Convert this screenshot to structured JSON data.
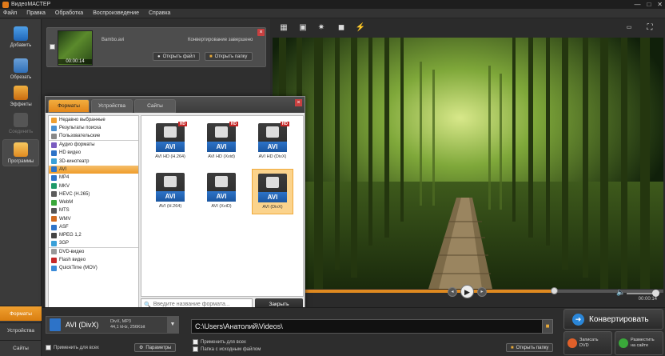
{
  "window": {
    "title": "ВидеоМАСТЕР"
  },
  "menu": [
    "Файл",
    "Правка",
    "Обработка",
    "Воспроизведение",
    "Справка"
  ],
  "sidebar": {
    "items": [
      {
        "label": "Добавить",
        "icon": "add-file-icon"
      },
      {
        "label": "Обрезать",
        "icon": "cut-icon"
      },
      {
        "label": "Эффекты",
        "icon": "effects-icon"
      },
      {
        "label": "Соединить",
        "icon": "join-icon"
      },
      {
        "label": "Программы",
        "icon": "programs-icon"
      }
    ],
    "bottom_tabs": [
      "Форматы",
      "Устройства",
      "Сайты"
    ]
  },
  "file_card": {
    "name": "Вambo.avi",
    "duration": "00:00:14",
    "status": "Конвертирование завершено",
    "open_file": "Открыть файл",
    "open_folder": "Открыть папку"
  },
  "player": {
    "time": "00:00:14",
    "progress": 0.72,
    "volume": 0.8
  },
  "dialog": {
    "tabs": [
      "Форматы",
      "Устройства",
      "Сайты"
    ],
    "list": [
      {
        "label": "Недавно выбранные",
        "color": "#f0a030"
      },
      {
        "label": "Результаты поиска",
        "color": "#4a90d0"
      },
      {
        "label": "Пользовательские",
        "color": "#888888"
      },
      {
        "label": "Аудио форматы",
        "color": "#7a5cc0"
      },
      {
        "label": "HD видео",
        "color": "#2d73c8"
      },
      {
        "label": "3D-кинотеатр",
        "color": "#3aa0d8"
      },
      {
        "label": "AVI",
        "color": "#2d73c8",
        "selected": true
      },
      {
        "label": "MP4",
        "color": "#2d73c8"
      },
      {
        "label": "MKV",
        "color": "#1f9a6a"
      },
      {
        "label": "HEVC (H.265)",
        "color": "#5c5c5c"
      },
      {
        "label": "WebM",
        "color": "#3aa83a"
      },
      {
        "label": "MTS",
        "color": "#555555"
      },
      {
        "label": "WMV",
        "color": "#d06a20"
      },
      {
        "label": "ASF",
        "color": "#2d73c8"
      },
      {
        "label": "MPEG 1,2",
        "color": "#444444"
      },
      {
        "label": "3GP",
        "color": "#3aa0d8"
      },
      {
        "label": "DVD-видео",
        "color": "#999999"
      },
      {
        "label": "Flash видео",
        "color": "#c62828"
      },
      {
        "label": "QuickTime (MOV)",
        "color": "#3a8ad8"
      }
    ],
    "formats": [
      {
        "caption": "AVI HD (H.264)",
        "badge": "AVI",
        "hd": "HD"
      },
      {
        "caption": "AVI HD (Xvid)",
        "badge": "AVI",
        "hd": "HD"
      },
      {
        "caption": "AVI HD (DivX)",
        "badge": "AVI",
        "hd": "HD"
      },
      {
        "caption": "AVI (H.264)",
        "badge": "AVI",
        "hd": ""
      },
      {
        "caption": "AVI (XviD)",
        "badge": "AVI",
        "hd": ""
      },
      {
        "caption": "AVI (DivX)",
        "badge": "AVI",
        "hd": "",
        "selected": true
      }
    ],
    "search_placeholder": "Введите название формата...",
    "close_button": "Закрыть"
  },
  "bottom": {
    "format_name": "AVI (DivX)",
    "format_info_1": "DivX, MP3",
    "format_info_2": "44,1 kHz, 256Kbit",
    "output_path": "C:\\Users\\Анатолий\\Videos\\",
    "apply_all": "Применить для всех",
    "params": "Параметры",
    "apply_all_2": "Применить для всех",
    "source_folder": "Папка с исходным файлом",
    "open_folder": "Открыть папку",
    "convert": "Конвертировать",
    "burn_dvd_1": "Записать",
    "burn_dvd_2": "DVD",
    "publish_1": "Разместить",
    "publish_2": "на сайте"
  }
}
